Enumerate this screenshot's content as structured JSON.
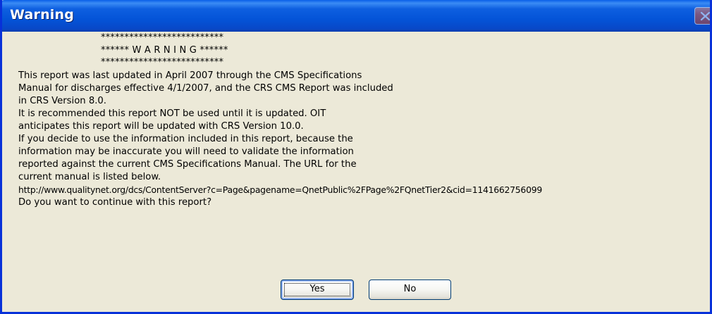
{
  "window": {
    "title": "Warning"
  },
  "message": {
    "header_lines": [
      "**************************",
      "****** W A R N I N G ******",
      "**************************"
    ],
    "body_lines": [
      "This report was last updated in April 2007 through the CMS Specifications",
      "Manual for discharges effective 4/1/2007, and the CRS CMS Report was included",
      "in CRS Version 8.0.",
      "It is recommended this report NOT be used until it is updated.  OIT",
      "anticipates this report will be updated with CRS Version 10.0.",
      "If you decide to use the information included in this report, because the",
      "information may be inaccurate you will need to validate the information",
      "reported against the current CMS Specifications Manual.  The URL for the",
      "current manual is listed below.",
      "http://www.qualitynet.org/dcs/ContentServer?c=Page&pagename=QnetPublic%2FPage%2FQnetTier2&cid=1141662756099",
      "Do you want to continue with this report?"
    ]
  },
  "buttons": {
    "yes_label": "Yes",
    "no_label": "No"
  },
  "icons": {
    "close": "close-icon"
  },
  "colors": {
    "titlebar": "#0454D8",
    "dialog_bg": "#ECE9D8",
    "button_border": "#003C74"
  }
}
